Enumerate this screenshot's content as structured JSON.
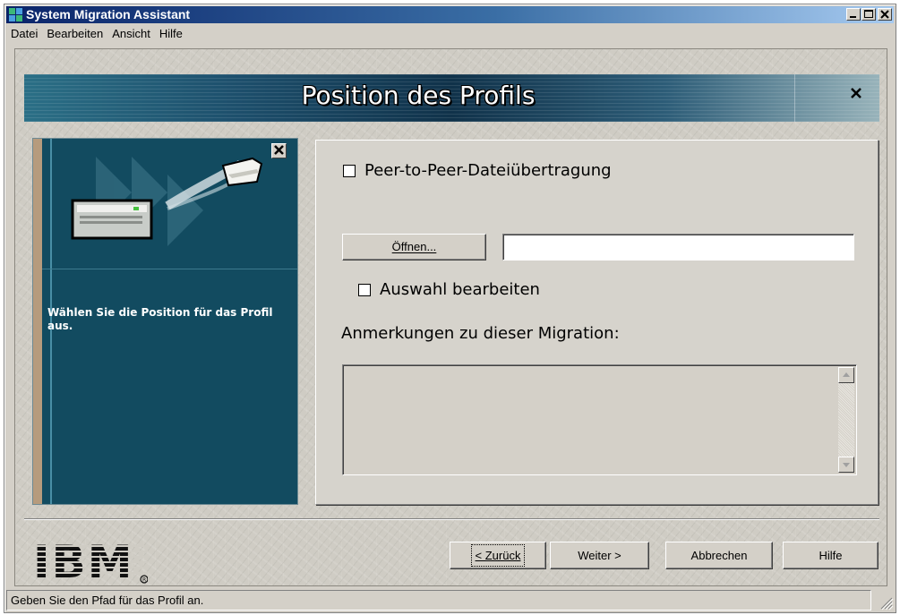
{
  "window": {
    "title": "System Migration Assistant"
  },
  "menu": {
    "items": [
      "Datei",
      "Bearbeiten",
      "Ansicht",
      "Hilfe"
    ]
  },
  "banner": {
    "title": "Position des Profils"
  },
  "side_panel": {
    "text": "Wählen Sie die Position für das Profil aus."
  },
  "form": {
    "p2p_label": "Peer-to-Peer-Dateiübertragung",
    "p2p_checked": false,
    "open_button_label": "Öffnen...",
    "path_value": "",
    "edit_selection_label": "Auswahl bearbeiten",
    "edit_selection_checked": false,
    "notes_label": "Anmerkungen zu dieser Migration:",
    "notes_value": ""
  },
  "footer": {
    "logo": "IBM",
    "back_label": "< Zurück",
    "next_label": "Weiter >",
    "cancel_label": "Abbrechen",
    "help_label": "Hilfe"
  },
  "statusbar": {
    "text": "Geben Sie den Pfad für das Profil an."
  },
  "icons": {
    "app": "migration-app-icon",
    "banner_close": "close-icon",
    "side_close": "close-icon",
    "illustration": "server-transfer-illustration"
  },
  "colors": {
    "title_bar": "#0a246a",
    "side_panel": "#124b60",
    "window_face": "#d4d0c8"
  }
}
